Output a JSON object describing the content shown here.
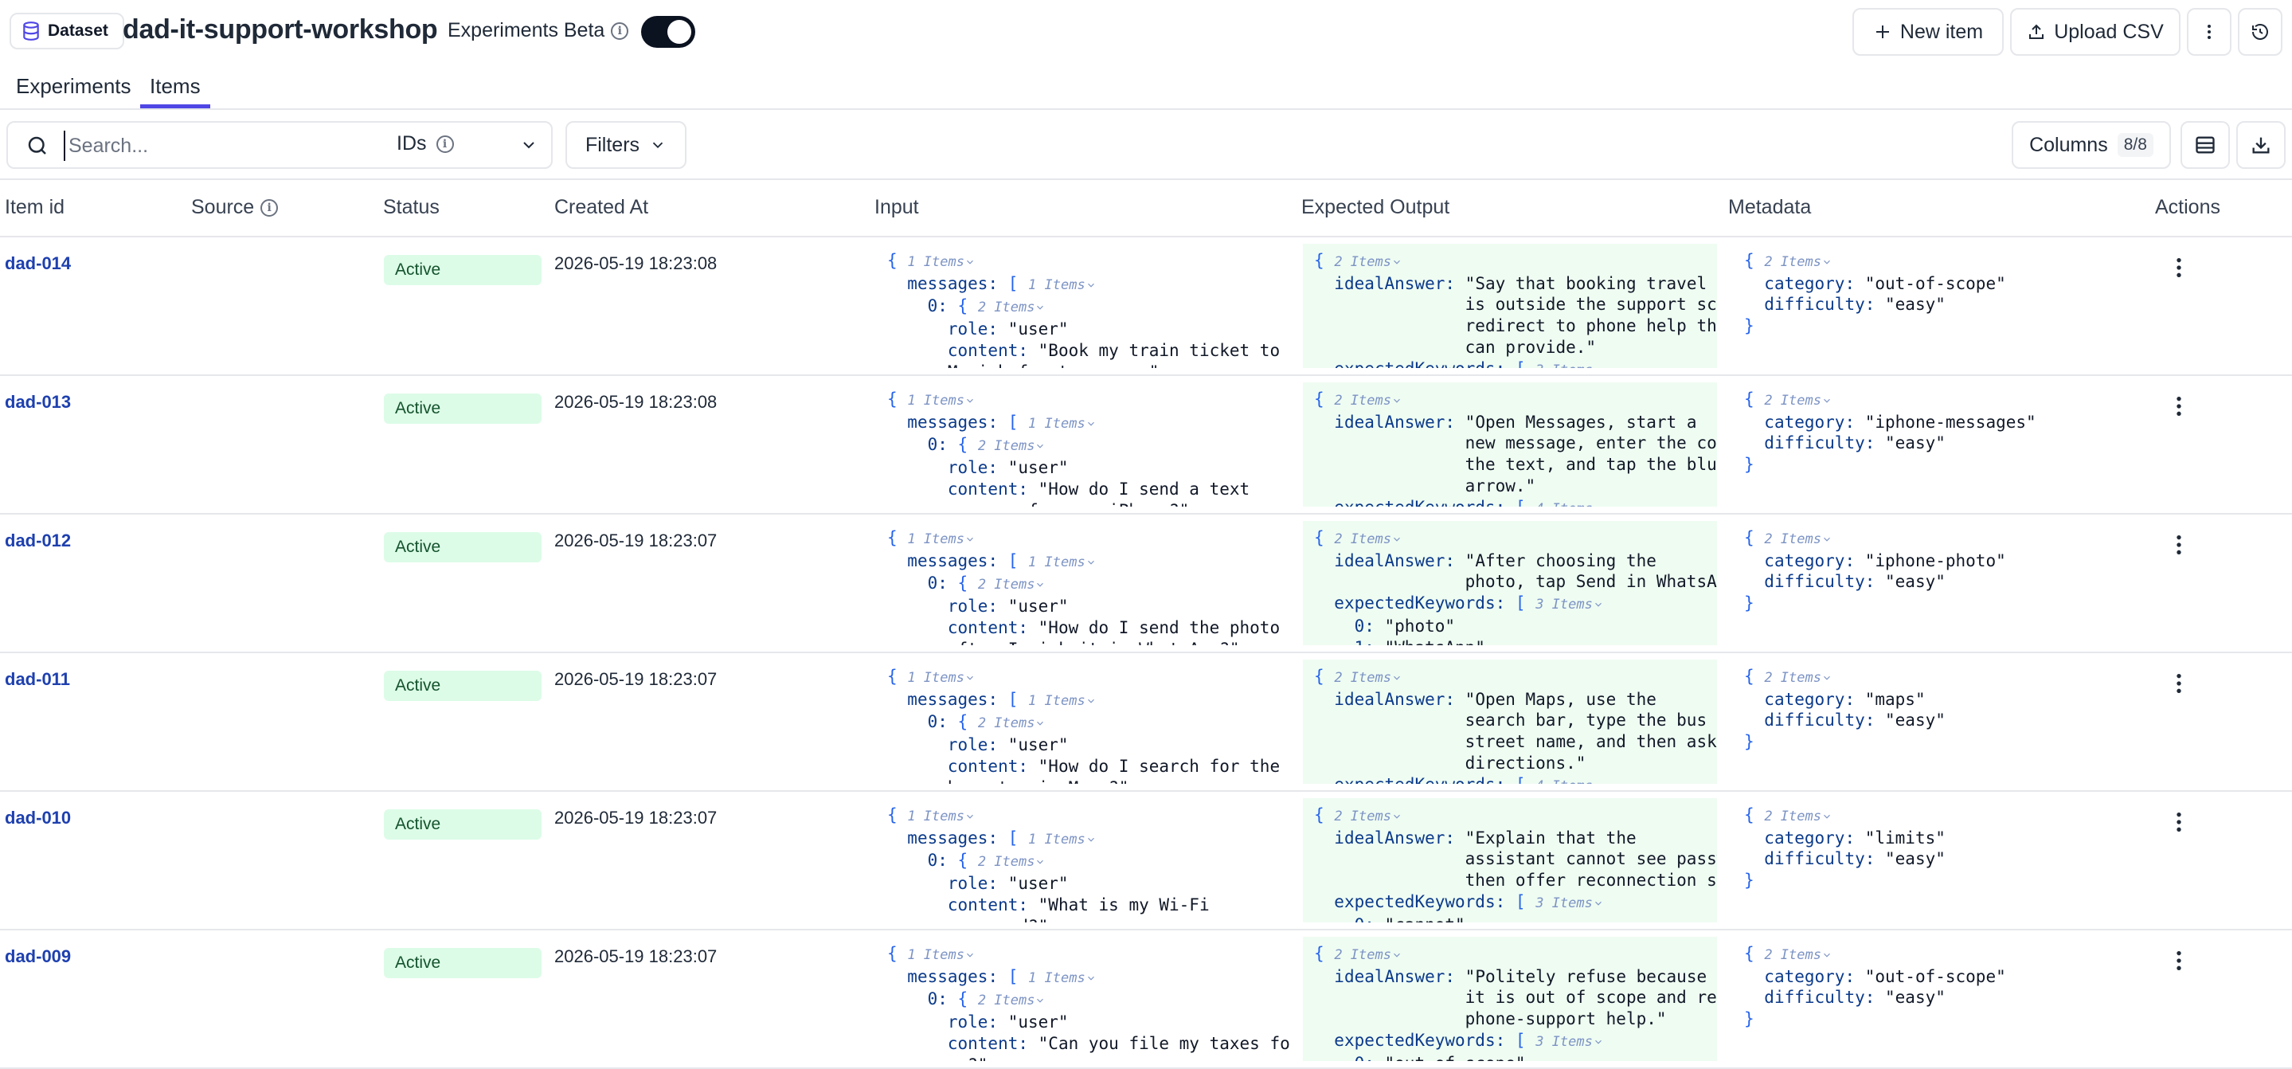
{
  "header": {
    "badge_label": "Dataset",
    "title": "dad-it-support-workshop",
    "experiments_beta_label": "Experiments Beta",
    "experiments_beta_enabled": true,
    "new_item_label": "New item",
    "upload_csv_label": "Upload CSV"
  },
  "tabs": [
    {
      "label": "Experiments",
      "active": false
    },
    {
      "label": "Items",
      "active": true
    }
  ],
  "toolbar": {
    "search_placeholder": "Search...",
    "search_value": "",
    "search_scope": "IDs",
    "filters_label": "Filters",
    "columns_label": "Columns",
    "columns_count": "8/8"
  },
  "columns": [
    "Item id",
    "Source",
    "Status",
    "Created At",
    "Input",
    "Expected Output",
    "Metadata",
    "Actions"
  ],
  "rows": [
    {
      "id": "dad-014",
      "status": "Active",
      "created": "2026-05-19 18:23:08",
      "content": "\"Book my train ticket to",
      "content2": "Munich for tomorrow.\"",
      "out": [
        [
          "idealAnswer: ",
          "\"Say that booking travel"
        ],
        [
          "",
          "is outside the support scope and"
        ],
        [
          "",
          "redirect to phone help the assistant"
        ],
        [
          "",
          "can provide.\""
        ],
        [
          "expectedKeywords: ",
          "[",
          "3 Items"
        ]
      ],
      "category": "\"out-of-scope\"",
      "difficulty": "\"easy\""
    },
    {
      "id": "dad-013",
      "status": "Active",
      "created": "2026-05-19 18:23:08",
      "content": "\"How do I send a text",
      "content2": "message from my iPhone?\"",
      "out": [
        [
          "idealAnswer: ",
          "\"Open Messages, start a"
        ],
        [
          "",
          "new message, enter the contact, type"
        ],
        [
          "",
          "the text, and tap the blue send"
        ],
        [
          "",
          "arrow.\""
        ],
        [
          "expectedKeywords: ",
          "[",
          "4 Items"
        ]
      ],
      "category": "\"iphone-messages\"",
      "difficulty": "\"easy\""
    },
    {
      "id": "dad-012",
      "status": "Active",
      "created": "2026-05-19 18:23:07",
      "content": "\"How do I send the photo",
      "content2": "after I pick it in WhatsApp?\"",
      "out": [
        [
          "idealAnswer: ",
          "\"After choosing the"
        ],
        [
          "",
          "photo, tap Send in WhatsApp.\""
        ],
        [
          "expectedKeywords: ",
          "[",
          "3 Items"
        ],
        [
          "  0: ",
          "\"photo\""
        ],
        [
          "  1: ",
          "\"WhatsApp\""
        ]
      ],
      "category": "\"iphone-photo\"",
      "difficulty": "\"easy\""
    },
    {
      "id": "dad-011",
      "status": "Active",
      "created": "2026-05-19 18:23:07",
      "content": "\"How do I search for the",
      "content2": "bus stop in Maps?\"",
      "out": [
        [
          "idealAnswer: ",
          "\"Open Maps, use the"
        ],
        [
          "",
          "search bar, type the bus stop or"
        ],
        [
          "",
          "street name, and then ask for"
        ],
        [
          "",
          "directions.\""
        ],
        [
          "expectedKeywords: ",
          "[",
          "4 Items"
        ]
      ],
      "category": "\"maps\"",
      "difficulty": "\"easy\""
    },
    {
      "id": "dad-010",
      "status": "Active",
      "created": "2026-05-19 18:23:07",
      "content": "\"What is my Wi-Fi",
      "content2": "password?\"",
      "out": [
        [
          "idealAnswer: ",
          "\"Explain that the"
        ],
        [
          "",
          "assistant cannot see passwords and"
        ],
        [
          "",
          "then offer reconnection steps.\""
        ],
        [
          "expectedKeywords: ",
          "[",
          "3 Items"
        ],
        [
          "  0: ",
          "\"cannot\""
        ]
      ],
      "category": "\"limits\"",
      "difficulty": "\"easy\""
    },
    {
      "id": "dad-009",
      "status": "Active",
      "created": "2026-05-19 18:23:07",
      "content": "\"Can you file my taxes for",
      "content2": "me?\"",
      "out": [
        [
          "idealAnswer: ",
          "\"Politely refuse because"
        ],
        [
          "",
          "it is out of scope and redirect to"
        ],
        [
          "",
          "phone-support help.\""
        ],
        [
          "expectedKeywords: ",
          "[",
          "3 Items"
        ],
        [
          "  0: ",
          "\"out of scope\""
        ]
      ],
      "category": "\"out-of-scope\"",
      "difficulty": "\"easy\""
    }
  ],
  "json_labels": {
    "one_item": "1 Items",
    "two_items": "2 Items",
    "messages_key": "messages: ",
    "zero_key": "0: ",
    "role_key": "role: ",
    "role_value": "\"user\"",
    "content_key": "content: ",
    "category_key": "category: ",
    "difficulty_key": "difficulty: "
  },
  "colors": {
    "accent": "#4f46e5",
    "id_link": "#1e40af",
    "status_bg": "#dcfce7",
    "expected_output_bg": "#effcf2"
  },
  "icons": [
    "database-icon",
    "info-icon",
    "plus-icon",
    "upload-icon",
    "more-vertical-icon",
    "history-icon",
    "search-icon",
    "chevron-down-icon",
    "table-layout-icon",
    "download-icon"
  ]
}
